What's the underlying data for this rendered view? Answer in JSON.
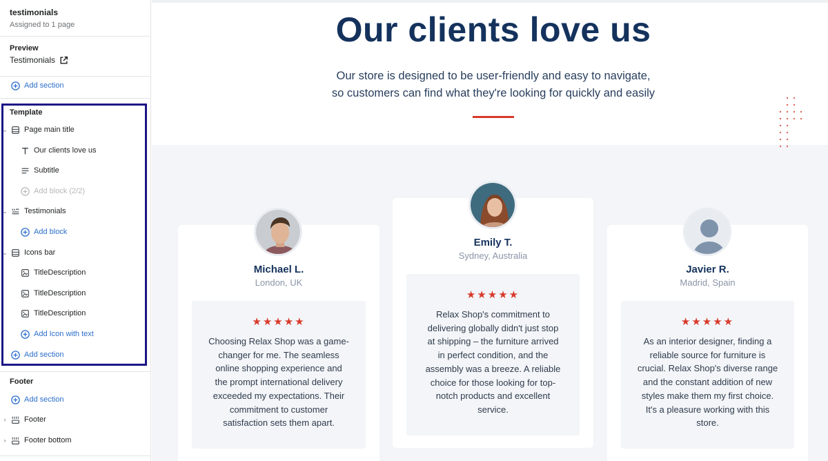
{
  "sidebar": {
    "header": {
      "title": "testimonials",
      "subtitle": "Assigned to 1 page"
    },
    "preview": {
      "label": "Preview",
      "link": "Testimonials"
    },
    "add_section_top": "Add section",
    "template": {
      "label": "Template",
      "page_main_title": "Page main title",
      "our_clients": "Our clients love us",
      "subtitle": "Subtitle",
      "add_block_disabled": "Add block (2/2)",
      "testimonials": "Testimonials",
      "add_block": "Add block",
      "icons_bar": "Icons bar",
      "title_descriptions": [
        "TitleDescription",
        "TitleDescription",
        "TitleDescription"
      ],
      "add_icon": "Add Icon with text",
      "add_section": "Add section"
    },
    "footer": {
      "label": "Footer",
      "add_section": "Add section",
      "footer": "Footer",
      "footer_bottom": "Footer bottom"
    }
  },
  "hero": {
    "title": "Our clients love us",
    "subtitle_line1": "Our store is designed to be user-friendly and easy to navigate,",
    "subtitle_line2": "so customers can find what they're looking for quickly and easily"
  },
  "testimonials": [
    {
      "name": "Michael L.",
      "location": "London, UK",
      "stars": "★★★★★",
      "lines": [
        "Choosing Relax Shop was a game-",
        "changer for me. The seamless",
        "online shopping experience and",
        "the prompt international delivery",
        "exceeded my expectations. Their",
        "commitment to customer",
        "satisfaction sets them apart."
      ]
    },
    {
      "name": "Emily T.",
      "location": "Sydney, Australia",
      "stars": "★★★★★",
      "lines": [
        "Relax Shop's commitment to",
        "delivering globally didn't just stop",
        "at shipping – the furniture arrived",
        "in perfect condition, and the",
        "assembly was a breeze. A reliable",
        "choice for those looking for top-",
        "notch products and excellent",
        "service."
      ]
    },
    {
      "name": "Javier R.",
      "location": "Madrid, Spain",
      "stars": "★★★★★",
      "lines": [
        "As an interior designer, finding a",
        "reliable source for furniture is",
        "crucial. Relax Shop's diverse range",
        "and the constant addition of new",
        "styles make them my first choice.",
        "It's a pleasure working with this",
        "store."
      ]
    }
  ],
  "colors": {
    "accent_red": "#d9392b",
    "navy": "#14325c",
    "link_blue": "#2c6ecb",
    "highlight_box": "#1b1585"
  }
}
